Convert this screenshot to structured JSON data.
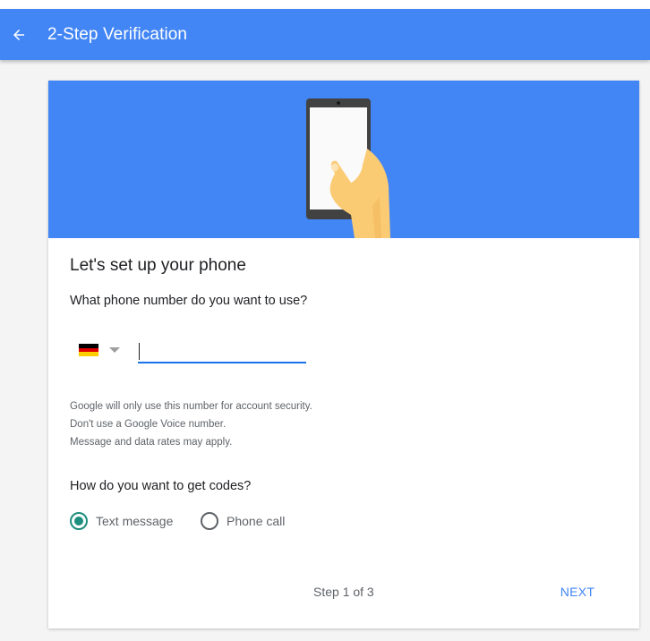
{
  "appbar": {
    "back_icon": "arrow-left-icon",
    "title": "2-Step Verification",
    "color": "#4285f4"
  },
  "card": {
    "hero_illustration": "hand-holding-phone",
    "heading": "Let's set up your phone",
    "phone_question": "What phone number do you want to use?",
    "country": {
      "flag": "germany-flag-icon",
      "flag_colors": [
        "#000000",
        "#dd0000",
        "#ffce00"
      ]
    },
    "phone_input": {
      "value": "",
      "placeholder": ""
    },
    "notes": [
      "Google will only use this number for account security.",
      "Don't use a Google Voice number.",
      "Message and data rates may apply."
    ],
    "codes_question": "How do you want to get codes?",
    "options": [
      {
        "label": "Text message",
        "selected": true
      },
      {
        "label": "Phone call",
        "selected": false
      }
    ],
    "step_text": "Step 1 of 3",
    "next_label": "NEXT",
    "accent": "#1e8e7e"
  }
}
